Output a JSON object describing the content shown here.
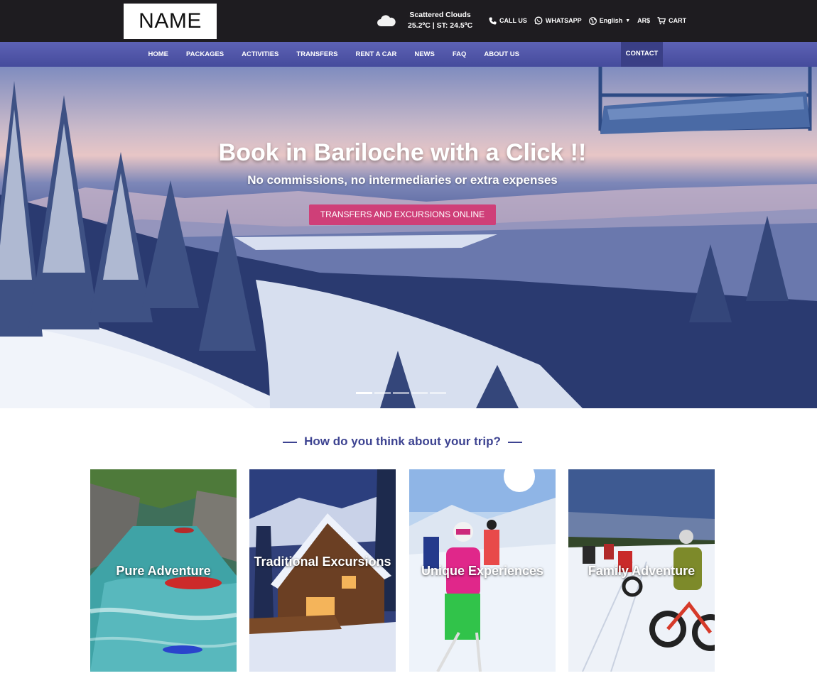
{
  "logo": {
    "text": "NAME"
  },
  "weather": {
    "condition": "Scattered Clouds",
    "temperature": "25.2ºC | ST: 24.5ºC",
    "icon": "cloud-icon"
  },
  "top_links": {
    "call": {
      "label": "CALL US",
      "icon": "phone-icon"
    },
    "whatsapp": {
      "label": "WHATSAPP",
      "icon": "whatsapp-icon"
    },
    "language": {
      "label": "English",
      "icon": "globe-icon"
    },
    "currency": {
      "label": "AR$"
    },
    "cart": {
      "label": "CART",
      "icon": "cart-icon"
    }
  },
  "nav": {
    "items": [
      "HOME",
      "PACKAGES",
      "ACTIVITIES",
      "TRANSFERS",
      "RENT A CAR",
      "NEWS",
      "FAQ",
      "ABOUT US"
    ],
    "contact": "CONTACT"
  },
  "hero": {
    "title": "Book in Bariloche with a Click !!",
    "subtitle": "No commissions, no intermediaries or extra expenses",
    "button": "TRANSFERS AND EXCURSIONS ONLINE",
    "slide_count": 5,
    "active_slide": 1
  },
  "section": {
    "heading": "How do you think about your trip?"
  },
  "cards": [
    {
      "label": "Pure Adventure"
    },
    {
      "label": "Traditional Excursions"
    },
    {
      "label": "Unique Experiences"
    },
    {
      "label": "Family Adventure"
    }
  ],
  "colors": {
    "topbar": "#1e1c20",
    "nav": "#4f55a8",
    "accent": "#cf3f78",
    "heading": "#3d4391"
  }
}
